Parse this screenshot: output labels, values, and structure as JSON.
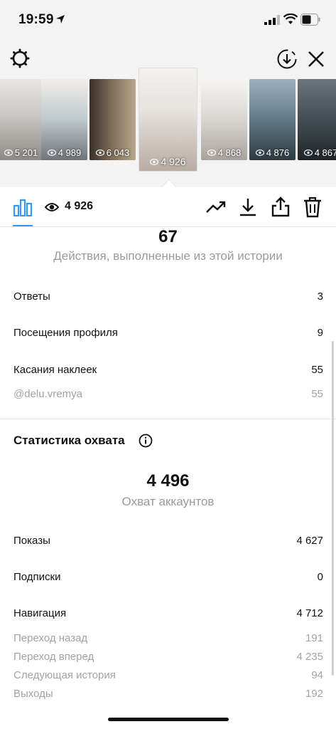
{
  "status": {
    "time": "19:59"
  },
  "toolbar": {
    "view_count": "4 926"
  },
  "thumbnails": [
    {
      "views": "5 201",
      "bg": "#c9c7c3"
    },
    {
      "views": "4 989",
      "bg": "#bfc8cc"
    },
    {
      "views": "6 043",
      "bg": "#7a6a55"
    },
    {
      "views": "4 926",
      "bg": "#e7e3df"
    },
    {
      "views": "4 868",
      "bg": "#d9d6d2"
    },
    {
      "views": "4 876",
      "bg": "#5f7a86"
    },
    {
      "views": "4 867",
      "bg": "#3f4a50"
    }
  ],
  "actions": {
    "total": "67",
    "caption": "Действия, выполненные из этой истории",
    "rows": [
      {
        "label": "Ответы",
        "value": "3"
      },
      {
        "label": "Посещения профиля",
        "value": "9"
      },
      {
        "label": "Касания наклеек",
        "value": "55"
      },
      {
        "label": "@delu.vremya",
        "value": "55"
      }
    ]
  },
  "reach": {
    "title": "Статистика охвата",
    "total": "4 496",
    "caption": "Охват аккаунтов",
    "rows": [
      {
        "label": "Показы",
        "value": "4 627"
      },
      {
        "label": "Подписки",
        "value": "0"
      },
      {
        "label": "Навигация",
        "value": "4 712"
      },
      {
        "label": "Переход назад",
        "value": "191"
      },
      {
        "label": "Переход вперед",
        "value": "4 235"
      },
      {
        "label": "Следующая история",
        "value": "94"
      },
      {
        "label": "Выходы",
        "value": "192"
      }
    ]
  },
  "colors": {
    "accent": "#3897f0",
    "muted_text": "#9a9a9a"
  }
}
